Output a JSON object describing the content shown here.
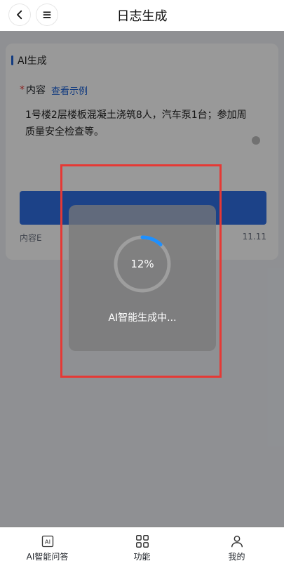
{
  "header": {
    "title": "日志生成"
  },
  "section": {
    "title": "AI生成"
  },
  "form": {
    "content_label": "内容",
    "required_mark": "*",
    "example_link": "查看示例",
    "content_value": "1号楼2层楼板混凝土浇筑8人，汽车泵1台；参加周质量安全检查等。",
    "primary_button_label": "",
    "hint_left": "内容E",
    "hint_right": "11.11"
  },
  "loading": {
    "progress_percent": 12,
    "progress_text": "12%",
    "message": "AI智能生成中..."
  },
  "bottom_nav": {
    "items": [
      {
        "label": "AI智能问答"
      },
      {
        "label": "功能"
      },
      {
        "label": "我的"
      }
    ]
  },
  "colors": {
    "accent": "#2f6fe3",
    "highlight": "#e53935",
    "progress": "#1e90ff",
    "ring_bg": "#9e9e9e"
  }
}
